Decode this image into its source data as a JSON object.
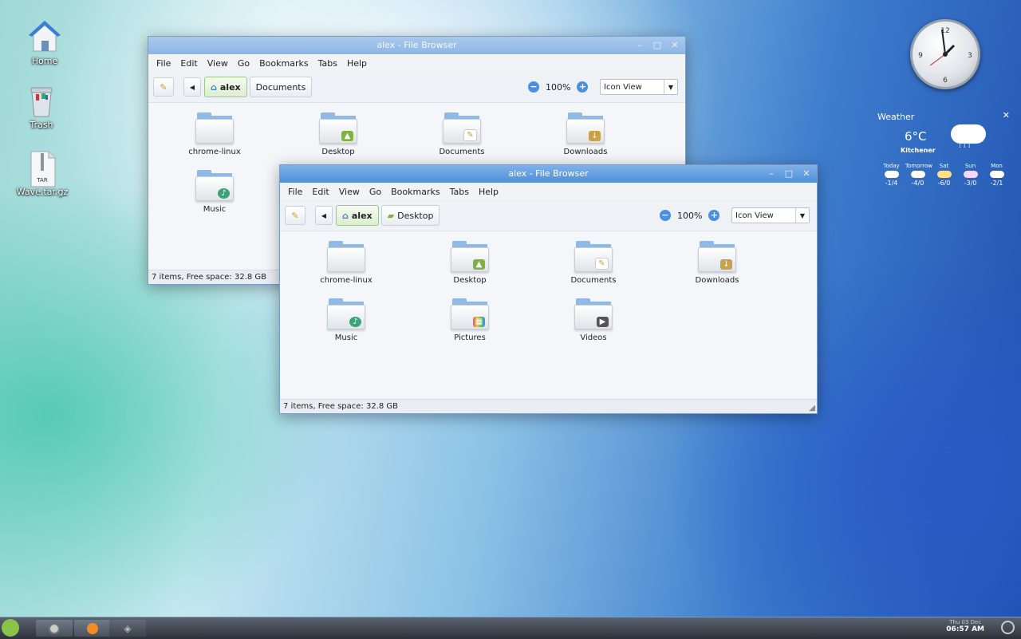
{
  "desktop": {
    "icons": [
      {
        "label": "Home"
      },
      {
        "label": "Trash"
      },
      {
        "label": "Wave.tar.gz",
        "badge": "TAR"
      }
    ]
  },
  "window_back": {
    "title": "alex - File Browser",
    "menu": [
      "File",
      "Edit",
      "View",
      "Go",
      "Bookmarks",
      "Tabs",
      "Help"
    ],
    "path": [
      "alex",
      "Documents"
    ],
    "zoom": "100%",
    "view": "Icon View",
    "items": [
      "chrome-linux",
      "Desktop",
      "Documents",
      "Downloads",
      "Music"
    ],
    "status": "7 items, Free space: 32.8 GB"
  },
  "window_front": {
    "title": "alex - File Browser",
    "menu": [
      "File",
      "Edit",
      "View",
      "Go",
      "Bookmarks",
      "Tabs",
      "Help"
    ],
    "path": [
      "alex",
      "Desktop"
    ],
    "zoom": "100%",
    "view": "Icon View",
    "items": [
      "chrome-linux",
      "Desktop",
      "Documents",
      "Downloads",
      "Music",
      "Pictures",
      "Videos"
    ],
    "status": "7 items, Free space: 32.8 GB"
  },
  "weather": {
    "title": "Weather",
    "temp": "6°C",
    "city": "Kitchener",
    "forecast": [
      {
        "day": "Today",
        "temps": "-1/4"
      },
      {
        "day": "Tomorrow",
        "temps": "-4/0"
      },
      {
        "day": "Sat",
        "temps": "-6/0"
      },
      {
        "day": "Sun",
        "temps": "-3/0"
      },
      {
        "day": "Mon",
        "temps": "-2/1"
      }
    ]
  },
  "taskbar": {
    "date": "Thu 03 Dec",
    "time": "06:57 AM"
  },
  "colors": {
    "accent": "#4f8fd8",
    "taskbar": "#3a414b"
  }
}
